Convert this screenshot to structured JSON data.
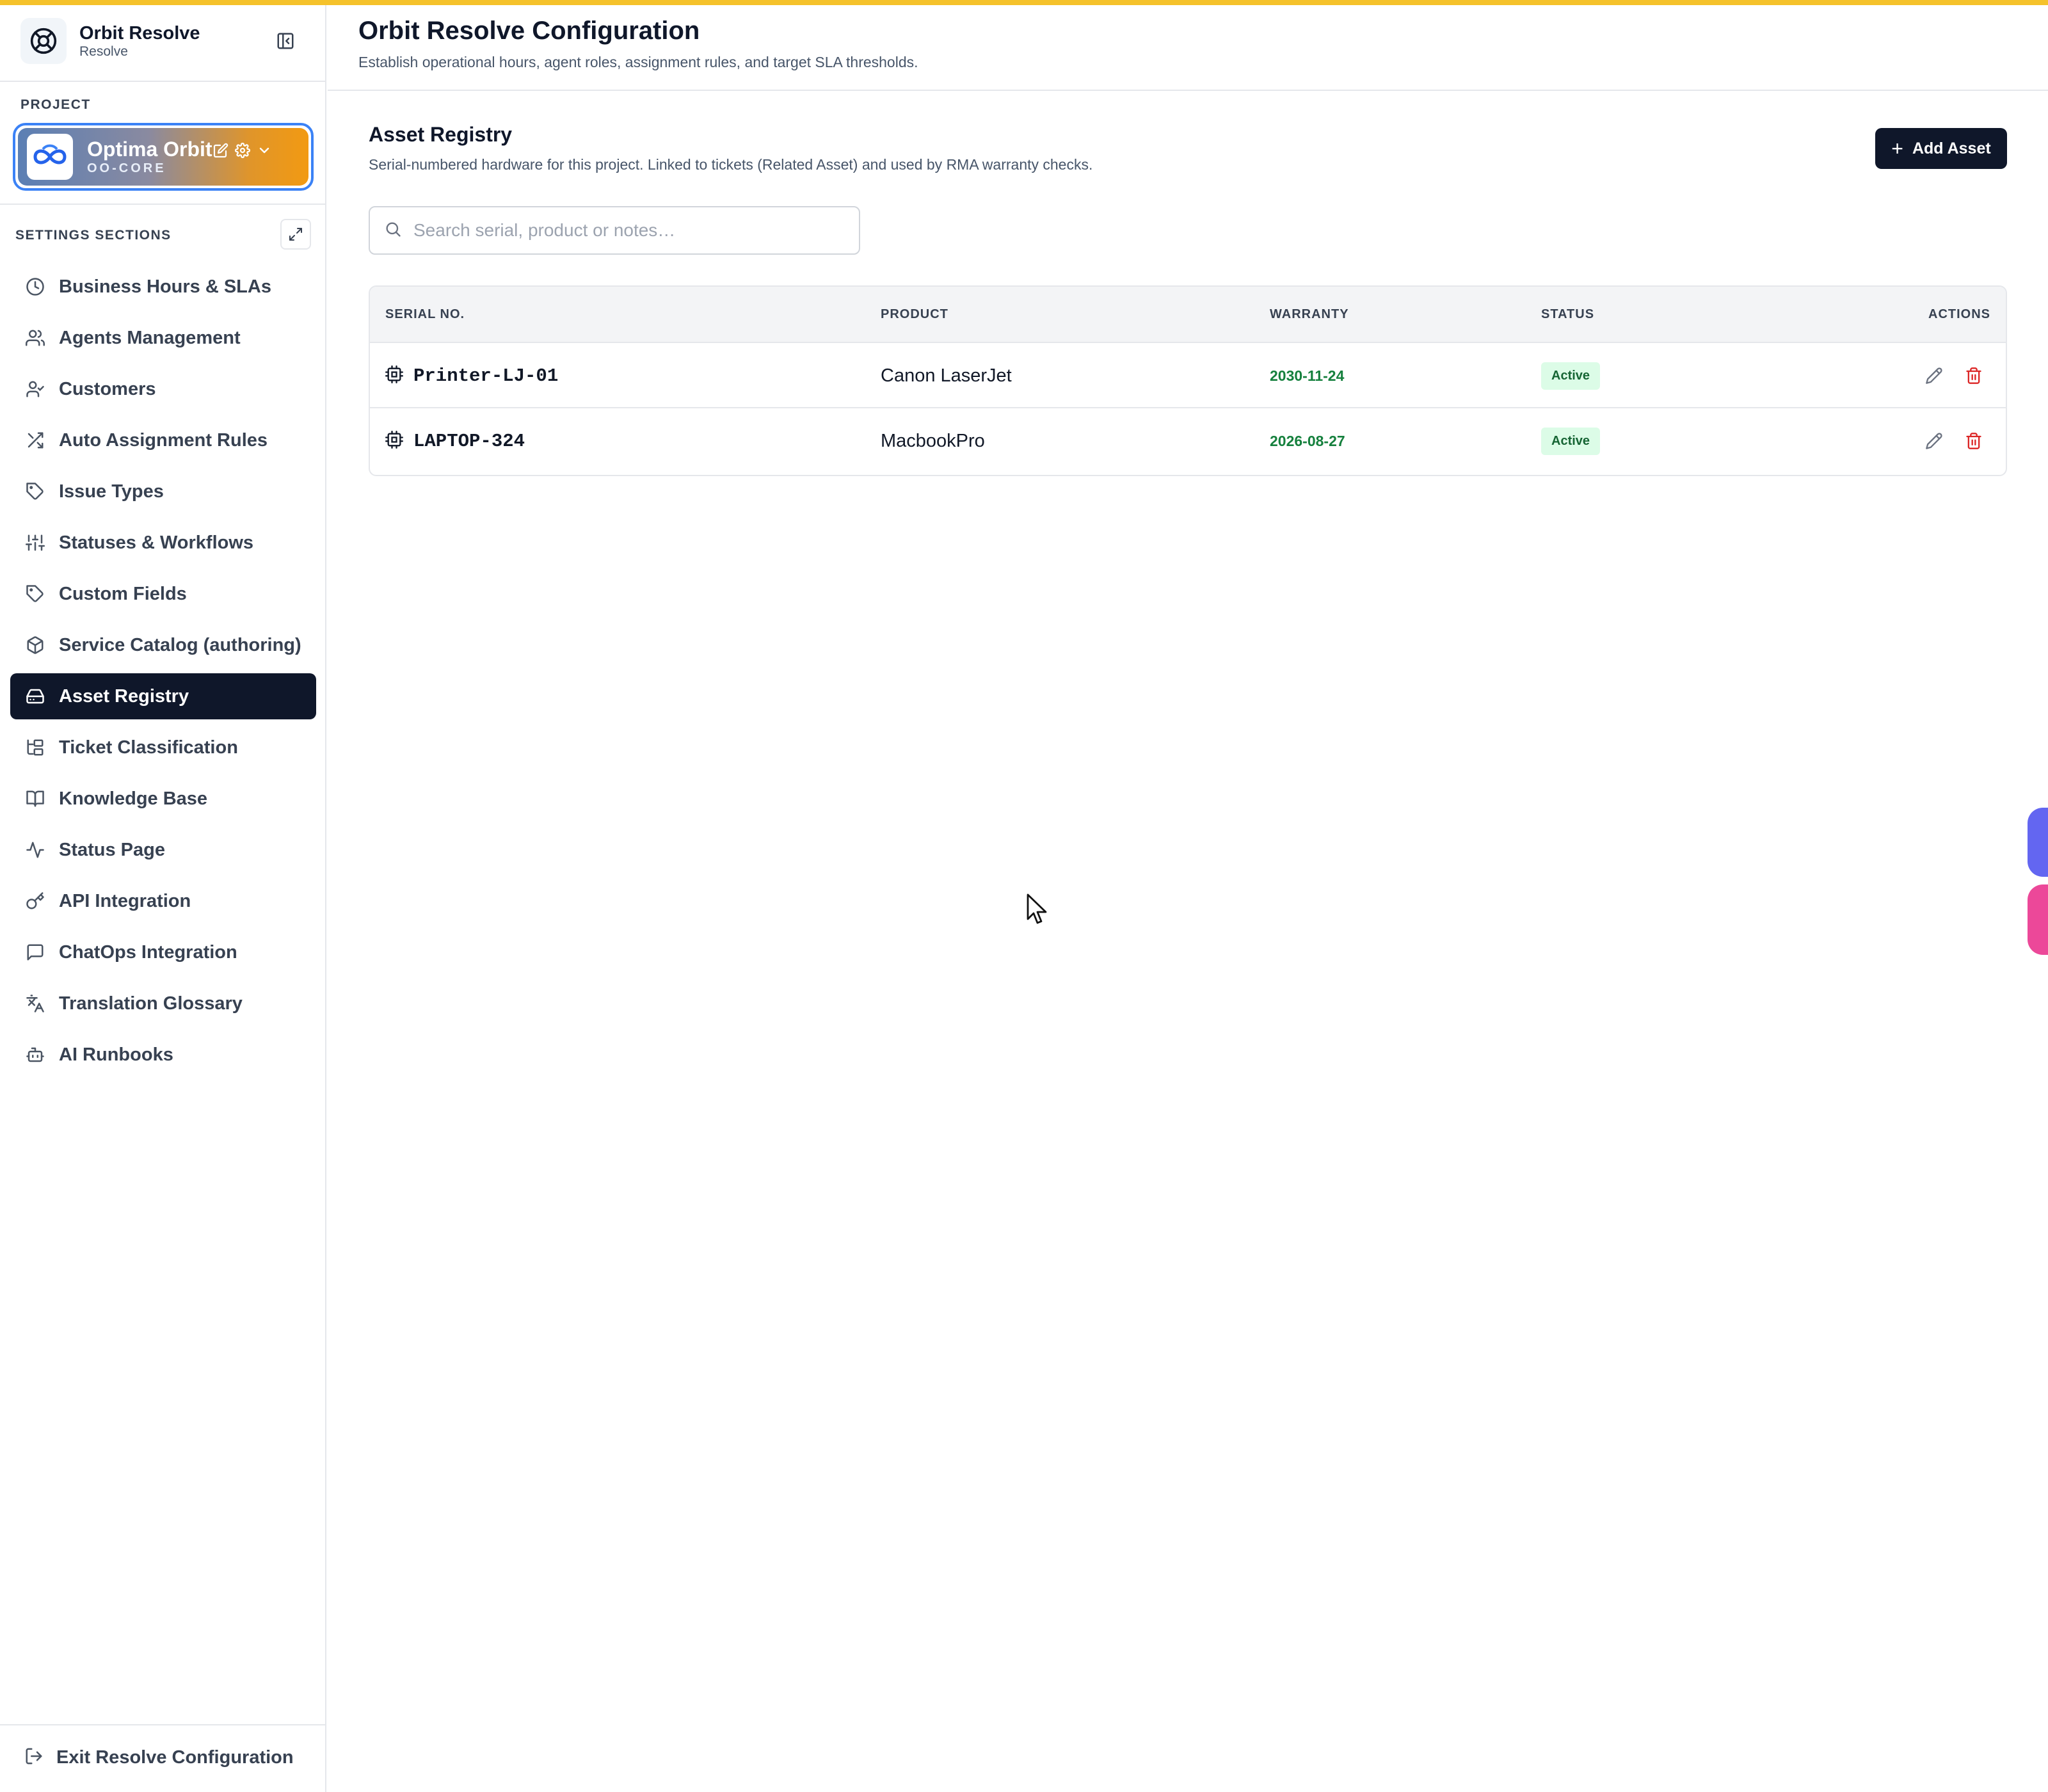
{
  "brand": {
    "name": "Orbit Resolve",
    "sub": "Resolve",
    "icon": "lifebuoy-icon"
  },
  "project": {
    "label": "PROJECT",
    "name": "Optima Orbit",
    "code": "OO-CORE",
    "gradient": [
      "#5b7fb4",
      "#f29a12"
    ],
    "border_color": "#3b82f6"
  },
  "settings_label": "SETTINGS SECTIONS",
  "nav": [
    {
      "label": "Business Hours & SLAs",
      "icon": "clock-icon"
    },
    {
      "label": "Agents Management",
      "icon": "users-icon"
    },
    {
      "label": "Customers",
      "icon": "user-check-icon"
    },
    {
      "label": "Auto Assignment Rules",
      "icon": "shuffle-icon"
    },
    {
      "label": "Issue Types",
      "icon": "tag-icon"
    },
    {
      "label": "Statuses & Workflows",
      "icon": "sliders-icon"
    },
    {
      "label": "Custom Fields",
      "icon": "tag-icon"
    },
    {
      "label": "Service Catalog (authoring)",
      "icon": "package-icon"
    },
    {
      "label": "Asset Registry",
      "icon": "hard-drive-icon",
      "active": true
    },
    {
      "label": "Ticket Classification",
      "icon": "folder-tree-icon"
    },
    {
      "label": "Knowledge Base",
      "icon": "book-open-icon"
    },
    {
      "label": "Status Page",
      "icon": "activity-icon"
    },
    {
      "label": "API Integration",
      "icon": "key-icon"
    },
    {
      "label": "ChatOps Integration",
      "icon": "message-square-icon"
    },
    {
      "label": "Translation Glossary",
      "icon": "languages-icon"
    },
    {
      "label": "AI Runbooks",
      "icon": "bot-icon"
    }
  ],
  "exit_label": "Exit Resolve Configuration",
  "header": {
    "title": "Orbit Resolve Configuration",
    "subtitle": "Establish operational hours, agent roles, assignment rules, and target SLA thresholds."
  },
  "section": {
    "title": "Asset Registry",
    "description": "Serial-numbered hardware for this project. Linked to tickets (Related Asset) and used by RMA warranty checks.",
    "add_label": "Add Asset"
  },
  "search": {
    "placeholder": "Search serial, product or notes…",
    "value": ""
  },
  "table": {
    "columns": [
      "SERIAL NO.",
      "PRODUCT",
      "WARRANTY",
      "STATUS",
      "ACTIONS"
    ],
    "rows": [
      {
        "serial": "Printer-LJ-01",
        "product": "Canon LaserJet",
        "warranty": "2030-11-24",
        "status": "Active"
      },
      {
        "serial": "LAPTOP-324",
        "product": "MacbookPro",
        "warranty": "2026-08-27",
        "status": "Active"
      }
    ]
  },
  "colors": {
    "accent_top": "#f5c22b",
    "nav_active_bg": "#0f172a",
    "warranty": "#15803d",
    "status_bg": "#dcfce7",
    "delete": "#dc2626"
  }
}
